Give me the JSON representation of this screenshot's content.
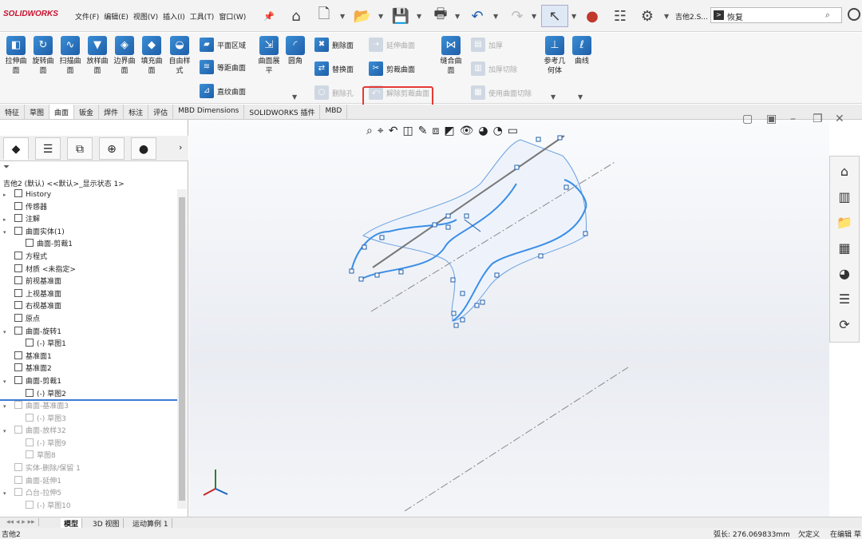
{
  "app": {
    "logo": "SOLIDWORKS",
    "doc_title": "吉他2.S...",
    "search_value": "恢复",
    "colors": {
      "accent": "#3a7bd5",
      "highlight": "#e53935"
    }
  },
  "menu": [
    "文件(F)",
    "编辑(E)",
    "视图(V)",
    "插入(I)",
    "工具(T)",
    "窗口(W)"
  ],
  "ribbon": {
    "large": [
      "拉伸曲面",
      "旋转曲面",
      "扫描曲面",
      "放样曲面",
      "边界曲面",
      "填充曲面",
      "自由样式",
      "曲面展平",
      "圆角",
      "缝合曲面",
      "参考几何体",
      "曲线"
    ],
    "small": {
      "planar": "平面区域",
      "offset": "等距曲面",
      "ruled": "直纹曲面",
      "delete_face": "删除面",
      "replace_face": "替换面",
      "delete_hole": "删除孔",
      "extend": "延伸曲面",
      "trim": "剪裁曲面",
      "untrim": "解除剪裁曲面",
      "thicken": "加厚",
      "thicken_cut": "加厚切除",
      "cut_with_surface": "使用曲面切除"
    }
  },
  "tabs": [
    "特征",
    "草图",
    "曲面",
    "钣金",
    "焊件",
    "标注",
    "评估",
    "MBD Dimensions",
    "SOLIDWORKS 插件",
    "MBD"
  ],
  "active_tab": 2,
  "tree": {
    "root": "吉他2 (默认) <<默认>_显示状态 1>",
    "items": [
      {
        "label": "History",
        "icon": "history-icon"
      },
      {
        "label": "传感器",
        "icon": "sensor-icon"
      },
      {
        "label": "注解",
        "icon": "annotation-icon"
      },
      {
        "label": "曲面实体(1)",
        "icon": "surface-body-icon"
      },
      {
        "label": "曲面-剪裁1",
        "icon": "trim-surface-icon"
      },
      {
        "label": "方程式",
        "icon": "equation-icon"
      },
      {
        "label": "材质 <未指定>",
        "icon": "material-icon"
      },
      {
        "label": "前视基准面",
        "icon": "plane-icon"
      },
      {
        "label": "上视基准面",
        "icon": "plane-icon"
      },
      {
        "label": "右视基准面",
        "icon": "plane-icon"
      },
      {
        "label": "原点",
        "icon": "origin-icon"
      },
      {
        "label": "曲面-旋转1",
        "icon": "revolve-surface-icon"
      },
      {
        "label": "(-) 草图1",
        "icon": "sketch-icon"
      },
      {
        "label": "基准面1",
        "icon": "plane-icon"
      },
      {
        "label": "基准面2",
        "icon": "plane-icon"
      },
      {
        "label": "曲面-剪裁1",
        "icon": "trim-surface-icon"
      },
      {
        "label": "(-) 草图2",
        "icon": "sketch-icon"
      },
      {
        "label": "曲面-基准面3",
        "icon": "planar-surface-icon"
      },
      {
        "label": "(-) 草图3",
        "icon": "sketch-icon"
      },
      {
        "label": "曲面-放样32",
        "icon": "loft-surface-icon"
      },
      {
        "label": "(-) 草图9",
        "icon": "sketch-icon"
      },
      {
        "label": "草图8",
        "icon": "sketch-icon"
      },
      {
        "label": "实体-删除/保留 1",
        "icon": "delete-body-icon"
      },
      {
        "label": "曲面-延伸1",
        "icon": "extend-surface-icon"
      },
      {
        "label": "凸台-拉伸5",
        "icon": "boss-extrude-icon"
      },
      {
        "label": "(-) 草图10",
        "icon": "sketch-icon"
      }
    ]
  },
  "bottom_tabs": [
    "模型",
    "3D 视图",
    "运动算例 1"
  ],
  "status": {
    "left": "吉他2",
    "length": "弧长: 276.069833mm",
    "defined": "欠定义",
    "mode": "在编辑 草"
  }
}
